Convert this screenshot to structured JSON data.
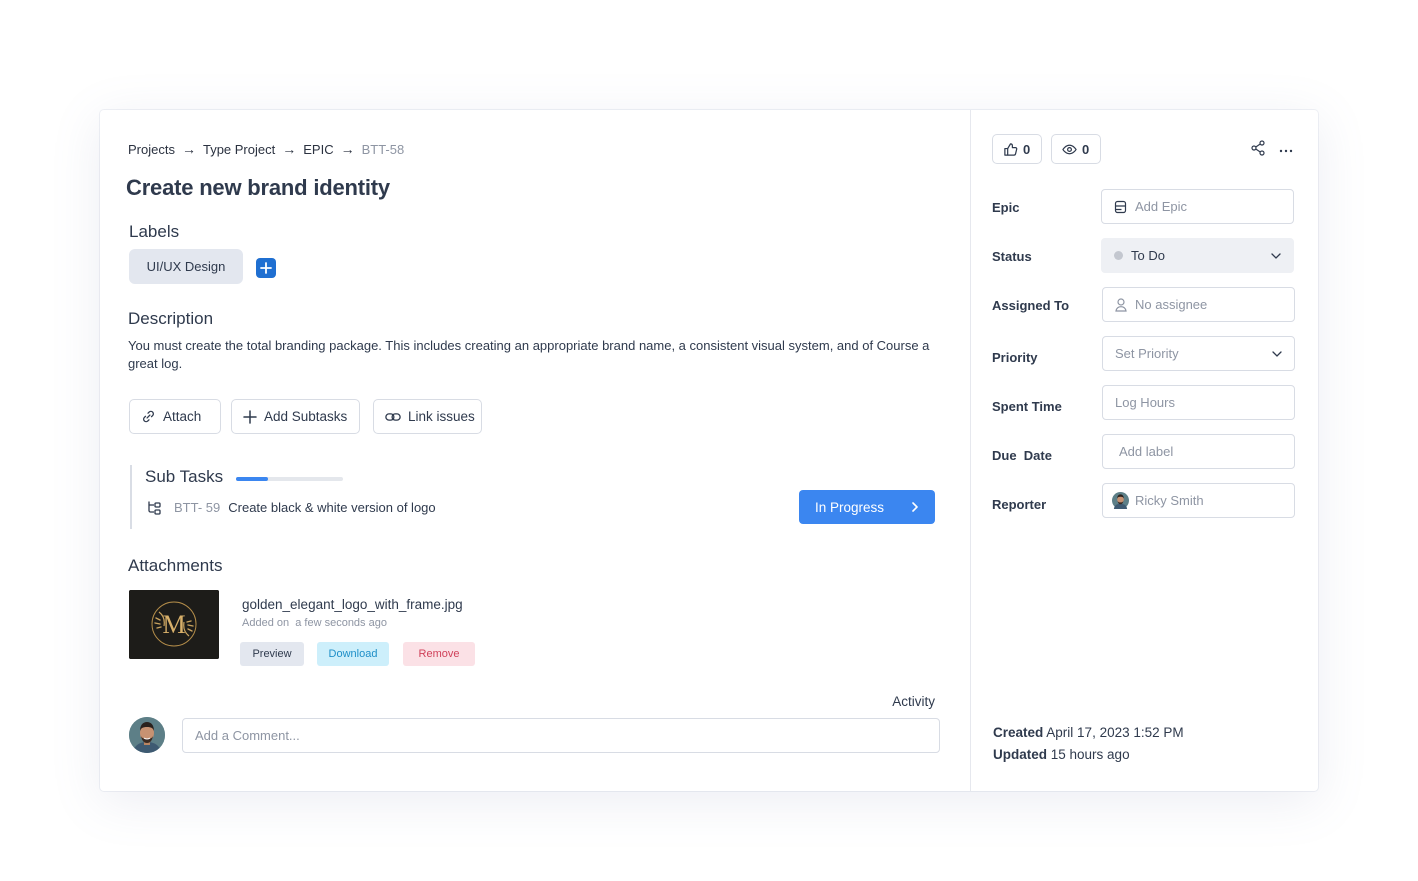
{
  "breadcrumb": {
    "items": [
      "Projects",
      "Type Project",
      "EPIC"
    ],
    "current": "BTT-58",
    "separator": "→"
  },
  "issue": {
    "title": "Create new brand identity"
  },
  "labels": {
    "heading": "Labels",
    "chips": [
      "UI/UX Design"
    ]
  },
  "description": {
    "heading": "Description",
    "text": "You must create the total branding package. This includes creating an appropriate brand name, a consistent visual system, and of Course a great log."
  },
  "actions": {
    "attach": "Attach",
    "add_subtasks": "Add Subtasks",
    "link_issues": "Link issues"
  },
  "subtasks": {
    "heading": "Sub Tasks",
    "progress": 0.3,
    "items": [
      {
        "key": "BTT- 59",
        "title": "Create black & white version of logo",
        "status": "In Progress"
      }
    ]
  },
  "attachments": {
    "heading": "Attachments",
    "files": [
      {
        "name": "golden_elegant_logo_with_frame.jpg",
        "added_label": "Added on",
        "added_time": "a few seconds ago",
        "preview": "Preview",
        "download": "Download",
        "remove": "Remove"
      }
    ]
  },
  "activity": {
    "heading": "Activity",
    "comment_placeholder": "Add a Comment..."
  },
  "sidebar": {
    "likes": "0",
    "watchers": "0",
    "fields": {
      "epic": {
        "label": "Epic",
        "value": "Add Epic"
      },
      "status": {
        "label": "Status",
        "value": "To Do"
      },
      "assigned_to": {
        "label": "Assigned To",
        "value": "No assignee"
      },
      "priority": {
        "label": "Priority",
        "value": "Set Priority"
      },
      "spent_time": {
        "label": "Spent Time",
        "value": "Log Hours"
      },
      "due_date": {
        "label": "Due  Date",
        "value": "Add label"
      },
      "reporter": {
        "label": "Reporter",
        "value": "Ricky Smith"
      }
    },
    "created_label": "Created",
    "created_value": "April 17, 2023 1:52 PM",
    "updated_label": "Updated",
    "updated_value": "15 hours ago"
  },
  "colors": {
    "accent": "#3b86f0",
    "primary_dark": "#1f6fd1",
    "download_bg": "#cdeffb",
    "remove_bg": "#fbe1e6"
  }
}
